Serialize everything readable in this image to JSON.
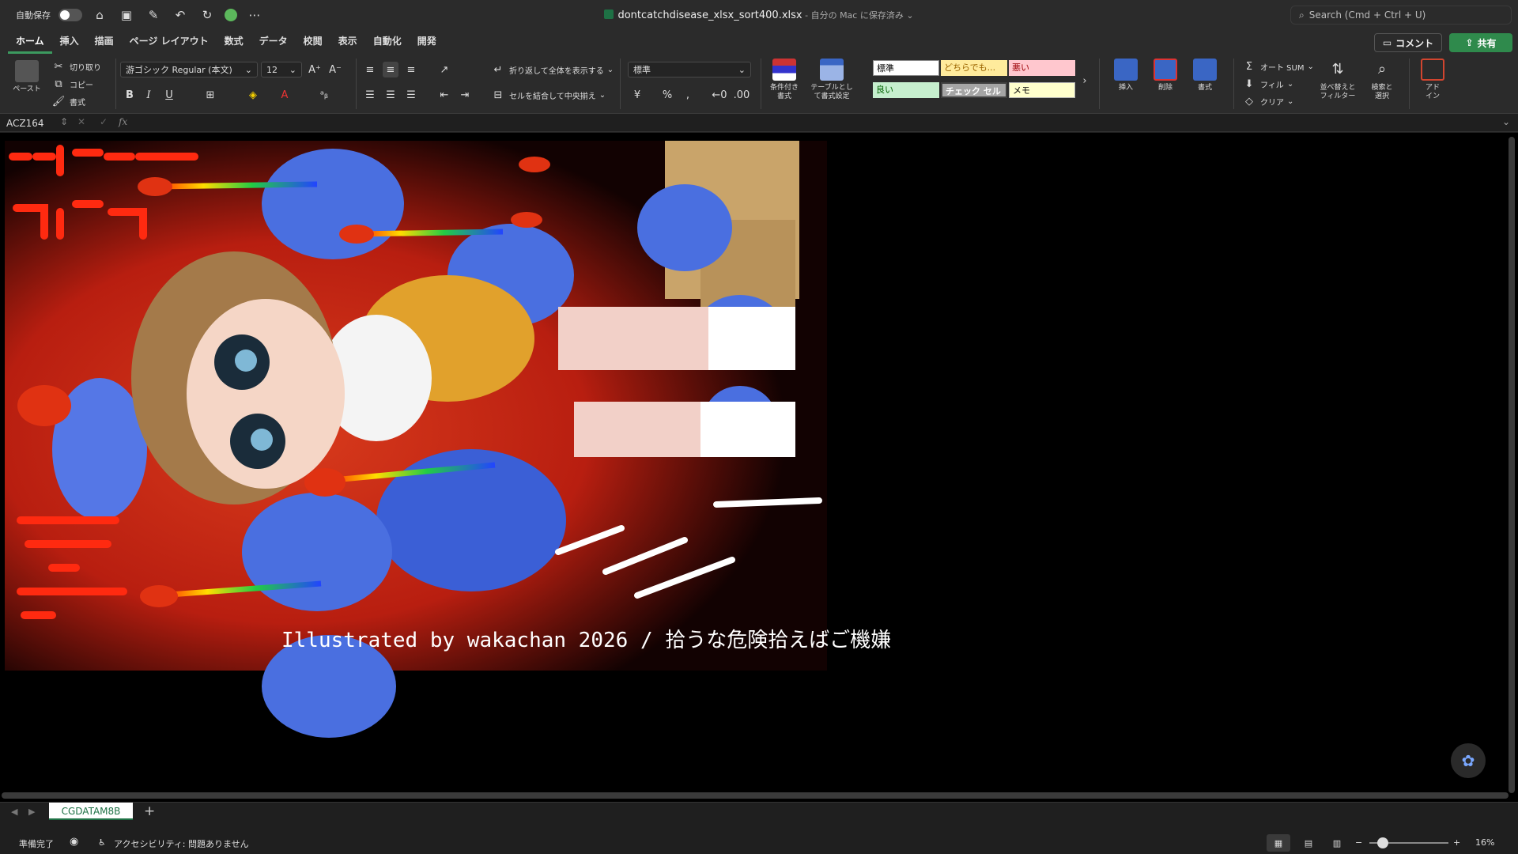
{
  "titlebar": {
    "autosave_label": "自動保存",
    "filename": "dontcatchdisease_xlsx_sort400.xlsx",
    "save_status": " - 自分の Mac に保存済み ⌄",
    "search_placeholder": "Search (Cmd + Ctrl + U)"
  },
  "tabs": [
    "ホーム",
    "挿入",
    "描画",
    "ページ レイアウト",
    "数式",
    "データ",
    "校閲",
    "表示",
    "自動化",
    "開発"
  ],
  "buttons": {
    "comment": "コメント",
    "share": "共有"
  },
  "ribbon": {
    "paste": "ペースト",
    "cut": "切り取り",
    "copy": "コピー",
    "format_painter": "書式",
    "font_name": "游ゴシック Regular (本文)",
    "font_size": "12",
    "bold": "B",
    "italic": "I",
    "underline": "U",
    "wrap_text": "折り返して全体を表示する",
    "merge_center": "セルを結合して中央揃え",
    "number_format": "標準",
    "percent": "%",
    "conditional_format": "条件付き\n書式",
    "table_format": "テーブルとして書式設定",
    "styles": {
      "normal": "標準",
      "neutral": "どちらでも...",
      "bad": "悪い",
      "good": "良い",
      "check_cell": "チェック セル",
      "note": "メモ"
    },
    "insert": "挿入",
    "delete": "削除",
    "format": "書式",
    "autosum": "オート SUM",
    "fill": "フィル",
    "clear": "クリア",
    "sort_filter": "並べ替えと\nフィルター",
    "find_select": "検索と\n選択",
    "addins": "アド\nイン"
  },
  "formula_bar": {
    "name_box": "ACZ164",
    "fx": "fx"
  },
  "artwork": {
    "caption": "Illustrated by wakachan 2026 / 拾うな危険拾えばご機嫌"
  },
  "sheet_tabs": {
    "active": "CGDATAM8B"
  },
  "status": {
    "ready": "準備完了",
    "accessibility": "アクセシビリティ: 問題ありません",
    "zoom": "16%"
  },
  "colors": {
    "accent": "#3c9a5f",
    "share": "#2f8a4c",
    "sheet_bg": "#000000"
  }
}
